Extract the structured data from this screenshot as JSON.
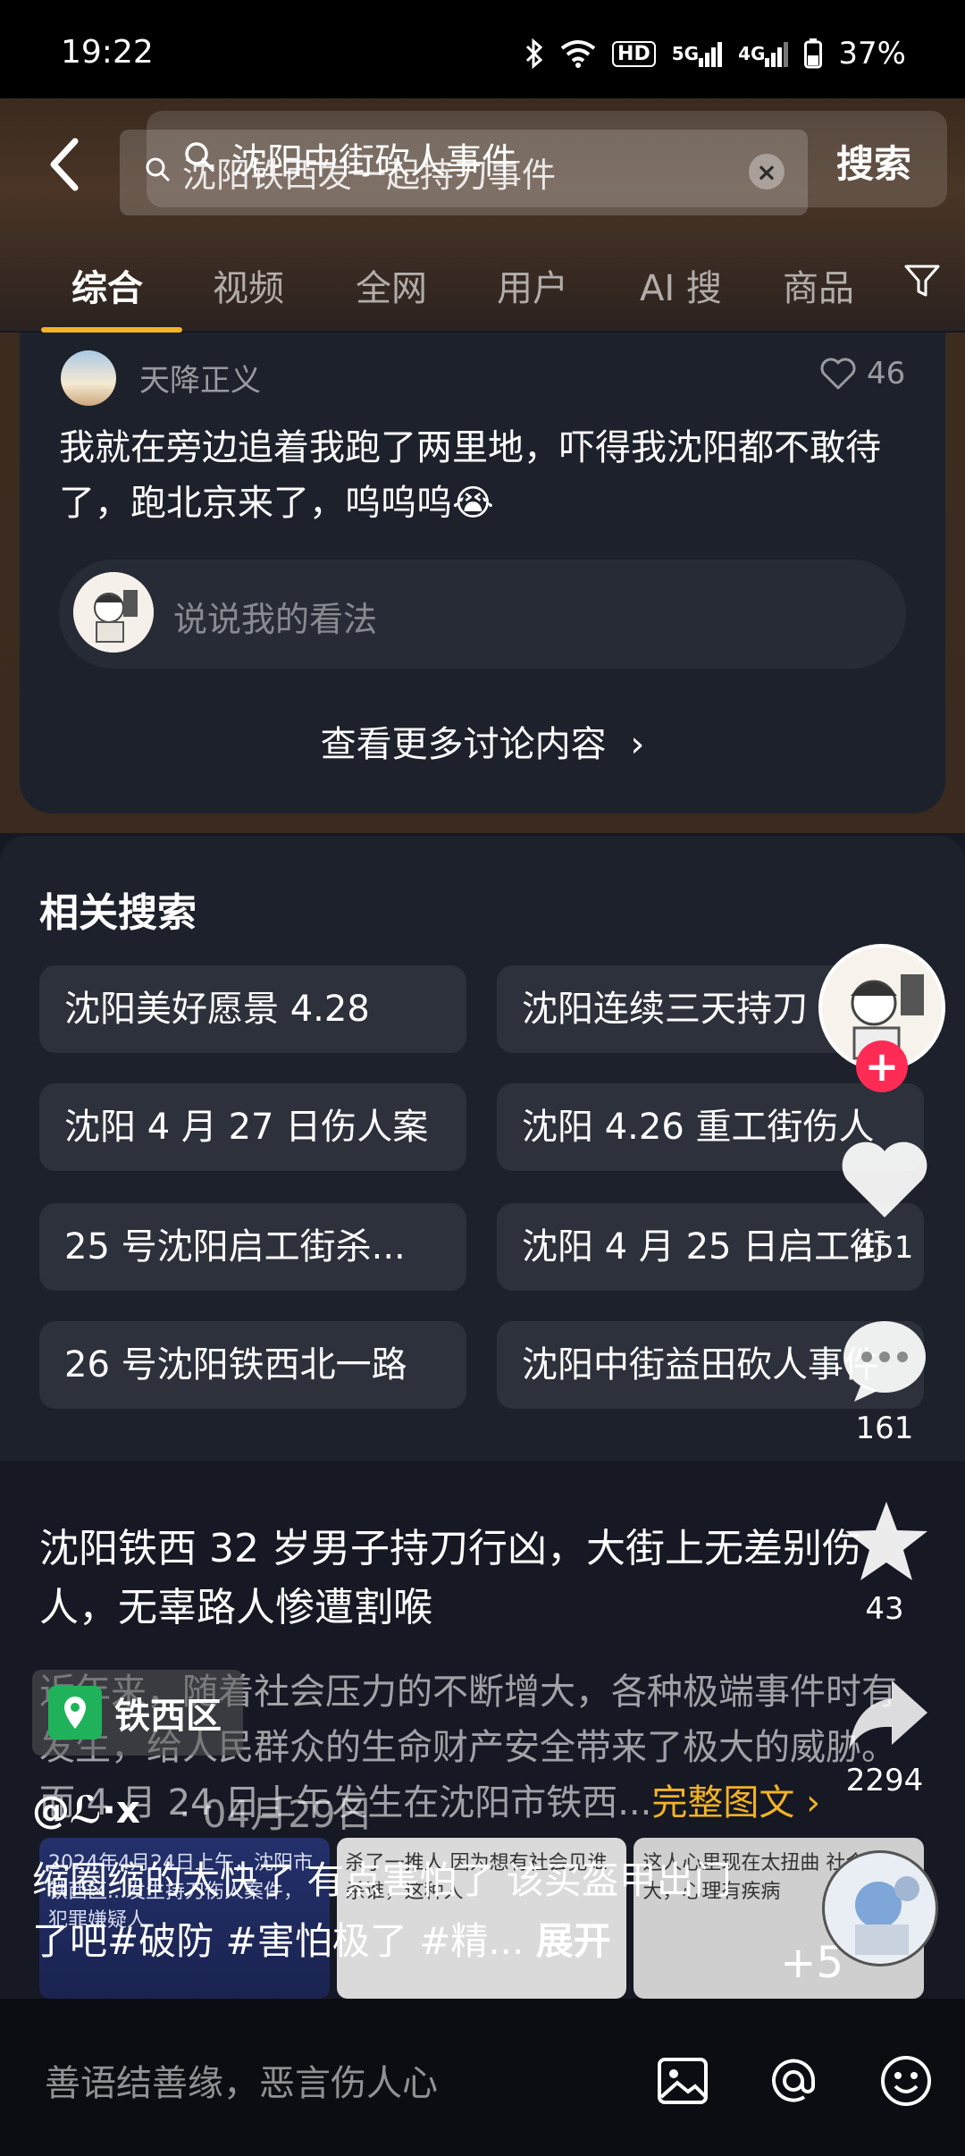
{
  "status": {
    "time": "19:22",
    "battery": "37%",
    "network1": "5G",
    "network2": "4G",
    "hd": "HD"
  },
  "search": {
    "query_top": "沈阳中街砍人事件",
    "query_under": "沈阳铁西发一起持刀事件",
    "button": "搜索",
    "button_under": "搜索"
  },
  "tabs": [
    "综合",
    "视频",
    "全网",
    "用户",
    "AI 搜",
    "商品"
  ],
  "discussion": {
    "username": "天降正义",
    "likes": "46",
    "comment": "我就在旁边追着我跑了两里地，吓得我沈阳都不敢待了，跑北京来了，呜呜呜😭",
    "reply_placeholder": "说说我的看法",
    "more": "查看更多讨论内容"
  },
  "related": {
    "title": "相关搜索",
    "items": [
      "沈阳美好愿景 4.28",
      "沈阳连续三天持刀",
      "沈阳 4 月 27 日伤人案",
      "沈阳 4.26 重工街伤人",
      "25 号沈阳启工街杀...",
      "沈阳 4 月 25 日启工街",
      "26 号沈阳铁西北一路",
      "沈阳中街益田砍人事件"
    ]
  },
  "article": {
    "title": "沈阳铁西 32 岁男子持刀行凶，大街上无差别伤人，无辜路人惨遭割喉",
    "body": "近年来，随着社会压力的不断增大，各种极端事件时有发生，给人民群众的生命财产安全带来了极大的威胁。而 4 月 24 日上午发生在沈阳市铁西...",
    "full_text": "完整图文",
    "thumb1": "2024年4月24日上午，沈阳市铁西区...发生持刀伤人案件，犯罪嫌疑人",
    "thumb2": "杀了一推人 因为想有社会见谁杀谁，这种人",
    "thumb3": "这人心里现在太扭曲 社会压力大，心理有疾病",
    "more_images": "+5"
  },
  "rail": {
    "likes": "451",
    "comments": "161",
    "favorites": "43",
    "shares": "2294"
  },
  "video": {
    "location": "铁西区",
    "author": "@ℒ·x",
    "date": "· 04月29日",
    "caption": "缩圈缩的太快了 有点害怕了 该买盔甲出门了吧#破防 #害怕极了 #精...",
    "expand": "展开"
  },
  "bottom": {
    "placeholder": "善语结善缘，恶言伤人心"
  },
  "colors": {
    "accent": "#f2b325",
    "follow": "#fe2c55",
    "bg": "#161823"
  }
}
